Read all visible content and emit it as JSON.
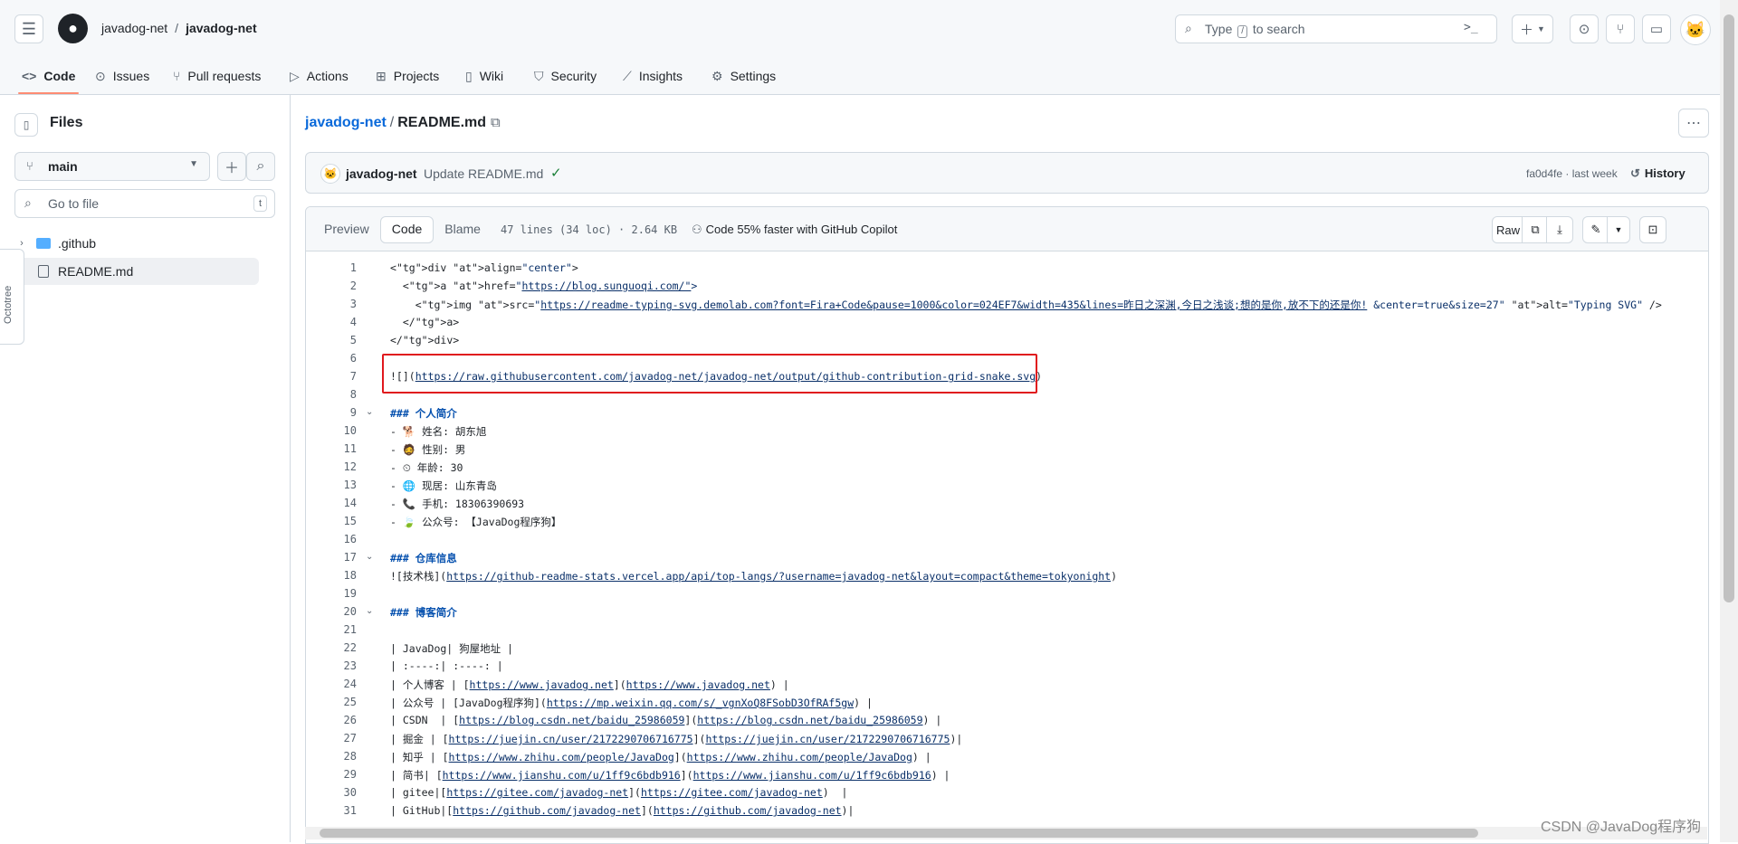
{
  "header": {
    "crumb_owner": "javadog-net",
    "crumb_sep": "/",
    "crumb_repo": "javadog-net",
    "search_pre": "Type",
    "search_key": "/",
    "search_post": "to search",
    "cmd_glyph": ">_"
  },
  "nav": {
    "tabs": [
      {
        "label": "Code",
        "icon": "code-icon"
      },
      {
        "label": "Issues",
        "icon": "issue-icon"
      },
      {
        "label": "Pull requests",
        "icon": "pull-request-icon"
      },
      {
        "label": "Actions",
        "icon": "play-icon"
      },
      {
        "label": "Projects",
        "icon": "table-icon"
      },
      {
        "label": "Wiki",
        "icon": "book-icon"
      },
      {
        "label": "Security",
        "icon": "shield-icon"
      },
      {
        "label": "Insights",
        "icon": "graph-icon"
      },
      {
        "label": "Settings",
        "icon": "gear-icon"
      }
    ]
  },
  "sidebar": {
    "title": "Files",
    "branch": "main",
    "goto_placeholder": "Go to file",
    "goto_key": "t",
    "tree": [
      {
        "label": ".github",
        "type": "folder"
      },
      {
        "label": "README.md",
        "type": "file",
        "selected": true
      }
    ],
    "octotree": "Octotree"
  },
  "file": {
    "path_owner": "javadog-net",
    "path_sep": "/",
    "path_file": "README.md",
    "commit_author": "javadog-net",
    "commit_message": "Update README.md",
    "commit_sha": "fa0d4fe · last week",
    "history_label": "History",
    "tab_preview": "Preview",
    "tab_code": "Code",
    "tab_blame": "Blame",
    "meta": "47 lines (34 loc) · 2.64 KB",
    "copilot": "Code 55% faster with GitHub Copilot",
    "raw_label": "Raw"
  },
  "code_lines": [
    "<div align=\"center\">",
    "  <a href=\"https://blog.sunguoqi.com/\">",
    "    <img src=\"https://readme-typing-svg.demolab.com?font=Fira+Code&pause=1000&color=024EF7&width=435&lines=昨日之深渊,今日之浅谈;想的是你,放不下的还是你! &center=true&size=27\" alt=\"Typing SVG\" />",
    "  </a>",
    "</div>",
    "",
    "![](https://raw.githubusercontent.com/javadog-net/javadog-net/output/github-contribution-grid-snake.svg)",
    "",
    "### 个人简介",
    "- 🐕 姓名: 胡东旭",
    "- 🧔 性别: 男",
    "- ⏲ 年龄: 30",
    "- 🌐 现居: 山东青岛",
    "- 📞 手机: 18306390693",
    "- 🍃 公众号: 【JavaDog程序狗】",
    "",
    "### 仓库信息",
    "![技术栈](https://github-readme-stats.vercel.app/api/top-langs/?username=javadog-net&layout=compact&theme=tokyonight)",
    "",
    "### 博客简介",
    "",
    "| JavaDog| 狗屋地址 |",
    "| :----:| :----: |",
    "| 个人博客 | [https://www.javadog.net](https://www.javadog.net) |",
    "| 公众号 | [JavaDog程序狗](https://mp.weixin.qq.com/s/_vgnXoQ8FSobD3OfRAf5gw) |",
    "| CSDN  | [https://blog.csdn.net/baidu_25986059](https://blog.csdn.net/baidu_25986059) |",
    "| 掘金 | [https://juejin.cn/user/2172290706716775](https://juejin.cn/user/2172290706716775)|",
    "| 知乎 | [https://www.zhihu.com/people/JavaDog](https://www.zhihu.com/people/JavaDog) |",
    "| 简书| [https://www.jianshu.com/u/1ff9c6bdb916](https://www.jianshu.com/u/1ff9c6bdb916) |",
    "| gitee|[https://gitee.com/javadog-net](https://gitee.com/javadog-net)  |",
    "| GitHub|[https://github.com/javadog-net](https://github.com/javadog-net)|"
  ],
  "watermark": "CSDN @JavaDog程序狗",
  "colors": {
    "accent": "#0969da",
    "tab_underline": "#fd8c73",
    "highlight_box": "#e0191e",
    "check": "#1a7f37"
  }
}
